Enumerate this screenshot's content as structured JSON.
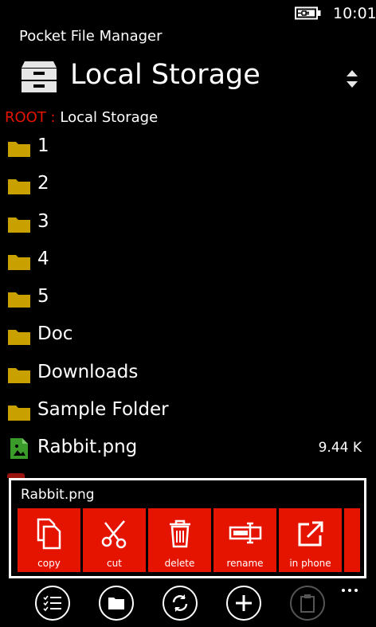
{
  "status": {
    "time": "10:01",
    "battery_icon": "battery-charging-icon"
  },
  "app": {
    "title": "Pocket File Manager"
  },
  "header": {
    "storage_name": "Local Storage",
    "storage_icon": "cabinet-icon",
    "sort_icon": "sort-icon"
  },
  "breadcrumb": {
    "root_label": "ROOT :",
    "path": "Local Storage"
  },
  "items": [
    {
      "name": "1",
      "type": "folder",
      "size": ""
    },
    {
      "name": "2",
      "type": "folder",
      "size": ""
    },
    {
      "name": "3",
      "type": "folder",
      "size": ""
    },
    {
      "name": "4",
      "type": "folder",
      "size": ""
    },
    {
      "name": "5",
      "type": "folder",
      "size": ""
    },
    {
      "name": "Doc",
      "type": "folder",
      "size": ""
    },
    {
      "name": "Downloads",
      "type": "folder",
      "size": ""
    },
    {
      "name": "Sample Folder",
      "type": "folder",
      "size": ""
    },
    {
      "name": "Rabbit.png",
      "type": "image",
      "size": "9.44 K"
    }
  ],
  "context_menu": {
    "title": "Rabbit.png",
    "actions": [
      {
        "label": "copy",
        "icon": "copy-icon"
      },
      {
        "label": "cut",
        "icon": "scissors-icon"
      },
      {
        "label": "delete",
        "icon": "trash-icon"
      },
      {
        "label": "rename",
        "icon": "rename-icon"
      },
      {
        "label": "in phone",
        "icon": "open-external-icon"
      }
    ]
  },
  "appbar": {
    "buttons": [
      {
        "icon": "checklist-icon"
      },
      {
        "icon": "folder-icon"
      },
      {
        "icon": "refresh-icon"
      },
      {
        "icon": "add-icon"
      },
      {
        "icon": "paste-icon"
      }
    ],
    "more": "more-icon"
  },
  "colors": {
    "accent": "#e51400",
    "folder": "#c8a000",
    "image_file": "#3a9a2a",
    "background": "#000000"
  }
}
